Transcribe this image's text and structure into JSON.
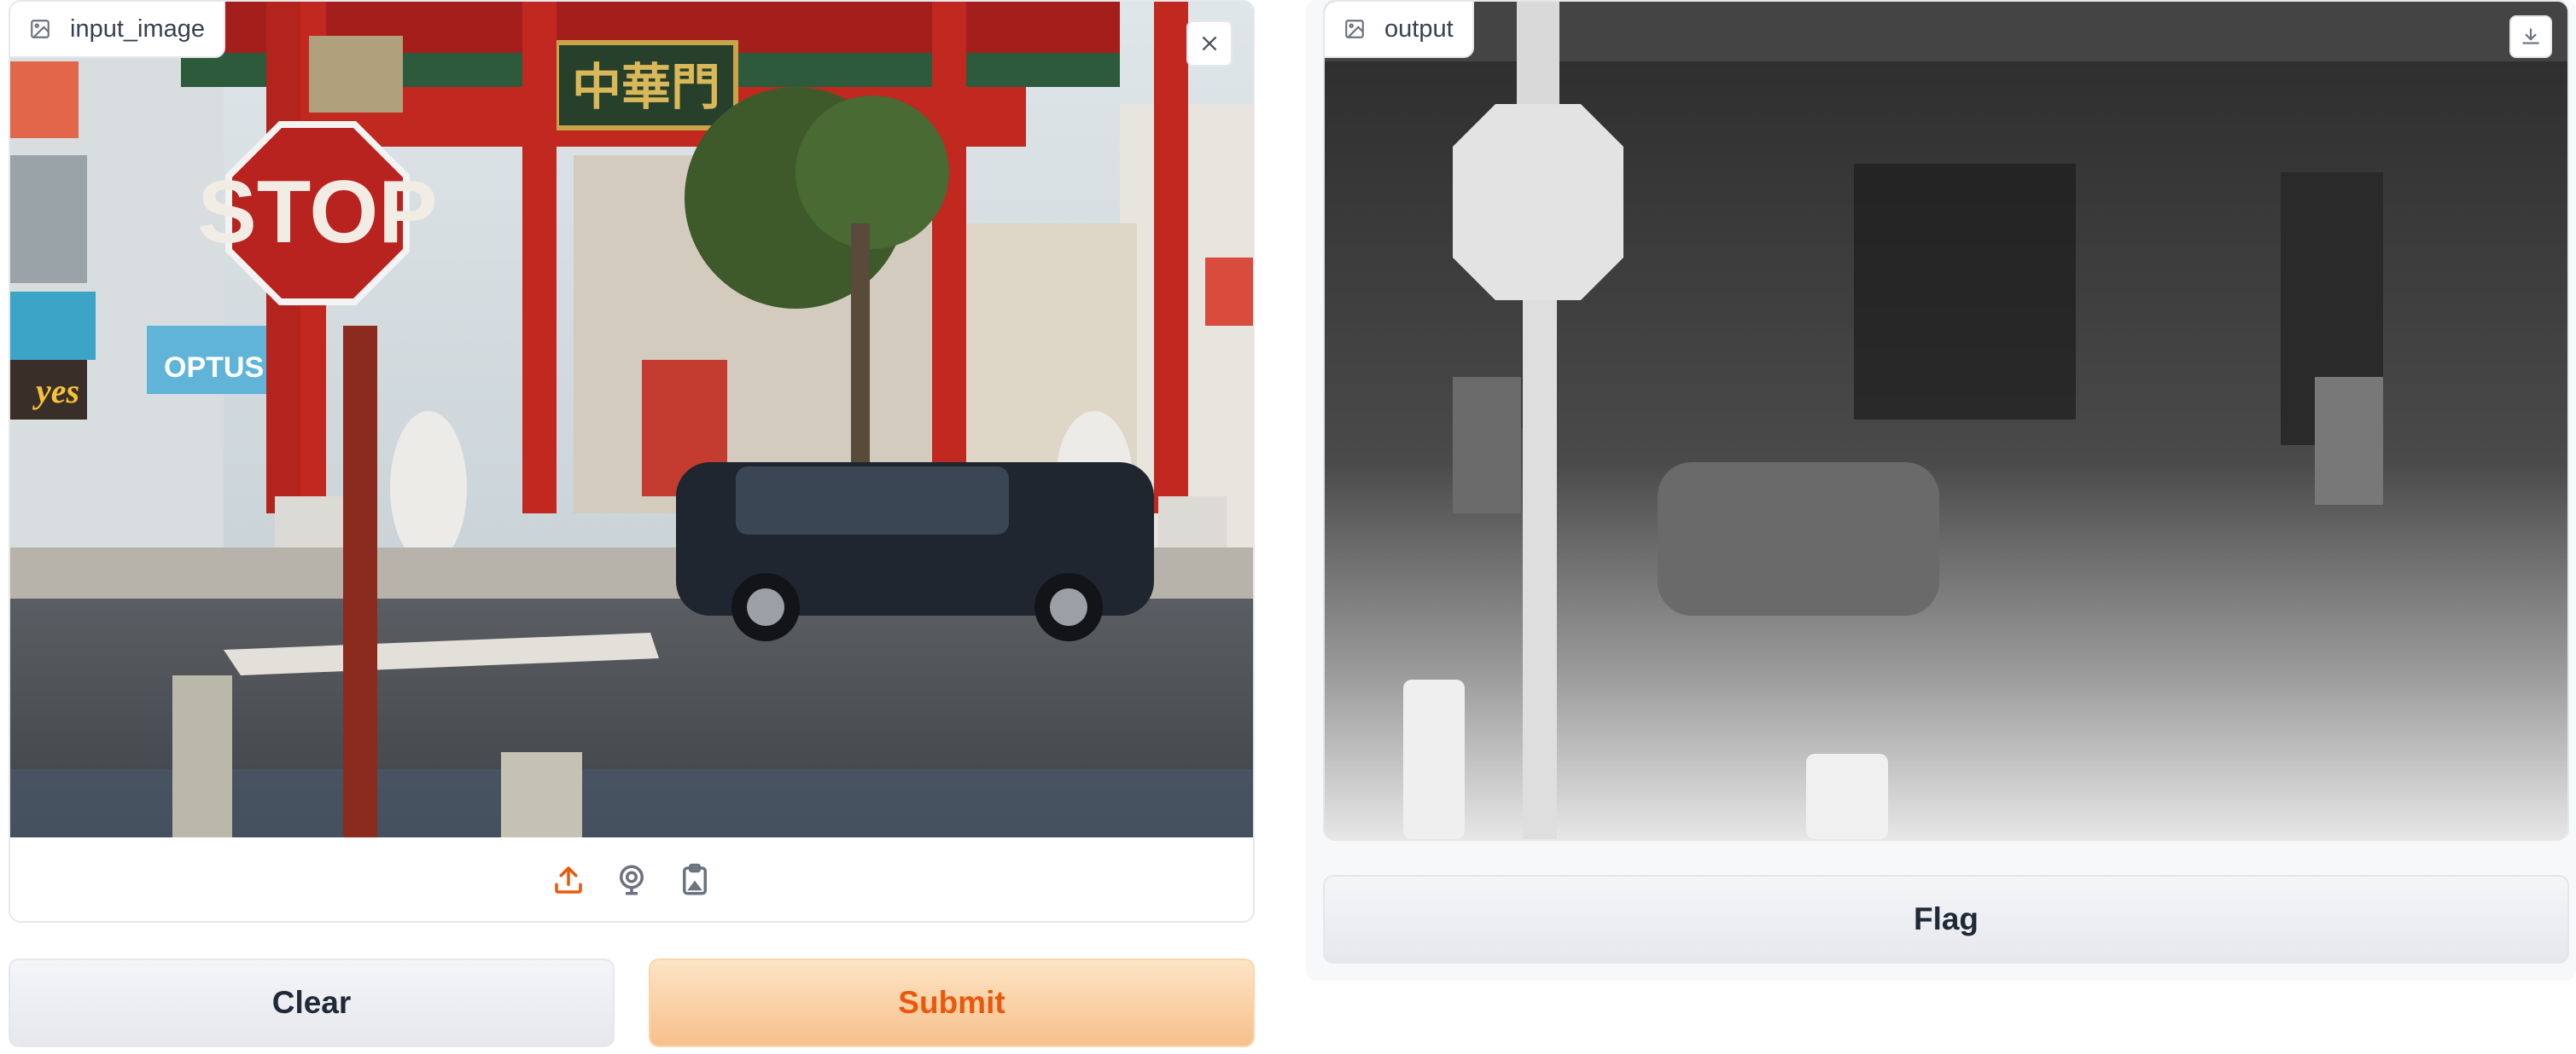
{
  "input": {
    "label": "input_image",
    "image_icon": "image-icon",
    "close_icon": "close-icon",
    "toolbar": [
      {
        "name": "upload-icon",
        "color": "#ea580c"
      },
      {
        "name": "webcam-icon",
        "color": "#6b7280"
      },
      {
        "name": "clipboard-icon",
        "color": "#6b7280"
      }
    ]
  },
  "output": {
    "label": "output",
    "image_icon": "image-icon",
    "download_icon": "download-icon"
  },
  "buttons": {
    "clear": "Clear",
    "submit": "Submit",
    "flag": "Flag"
  },
  "scene_text": {
    "stop_sign": "STOP",
    "gate_sign": "中華門",
    "optus": "OPTUS",
    "yes": "yes"
  },
  "colors": {
    "accent": "#ea580c",
    "submit_bg": "#f7c08a",
    "border": "#e5e7eb"
  }
}
